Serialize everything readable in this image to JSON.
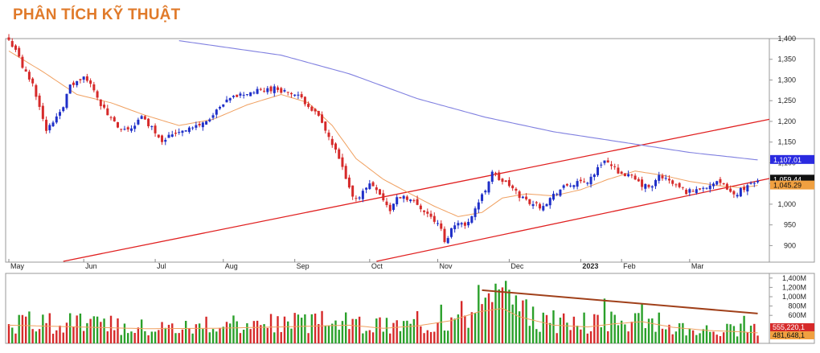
{
  "header": {
    "title": "PHÂN TÍCH KỸ THUẬT"
  },
  "colors": {
    "up": "#1f2fc8",
    "down": "#d62a2a",
    "vol_up": "#2aa02a",
    "vol_down": "#d62a2a",
    "ma_short": "#f0a060",
    "ma_long": "#8080e0",
    "channel": "#e02020",
    "vol_trend": "#a0401a"
  },
  "chart_data": [
    {
      "type": "candlestick",
      "title": "",
      "x_labels": [
        "May",
        "Jun",
        "Jul",
        "Aug",
        "Sep",
        "Oct",
        "Nov",
        "Dec",
        "2023",
        "Feb",
        "Mar"
      ],
      "y_ticks": [
        "1,400",
        "1,350",
        "1,300",
        "1,250",
        "1,200",
        "1,150",
        "1,100",
        "1,050",
        "1,000",
        "950",
        "900"
      ],
      "ylim": [
        860,
        1400
      ],
      "close_path": [
        [
          0,
          1395
        ],
        [
          2,
          1375
        ],
        [
          4,
          1330
        ],
        [
          7,
          1290
        ],
        [
          9,
          1240
        ],
        [
          11,
          1175
        ],
        [
          13,
          1200
        ],
        [
          16,
          1240
        ],
        [
          18,
          1285
        ],
        [
          22,
          1305
        ],
        [
          25,
          1280
        ],
        [
          27,
          1240
        ],
        [
          30,
          1205
        ],
        [
          33,
          1175
        ],
        [
          36,
          1185
        ],
        [
          39,
          1210
        ],
        [
          42,
          1185
        ],
        [
          45,
          1155
        ],
        [
          48,
          1170
        ],
        [
          51,
          1180
        ],
        [
          54,
          1185
        ],
        [
          57,
          1195
        ],
        [
          60,
          1215
        ],
        [
          63,
          1240
        ],
        [
          66,
          1260
        ],
        [
          70,
          1268
        ],
        [
          74,
          1275
        ],
        [
          78,
          1280
        ],
        [
          82,
          1270
        ],
        [
          85,
          1260
        ],
        [
          88,
          1240
        ],
        [
          91,
          1210
        ],
        [
          94,
          1160
        ],
        [
          97,
          1110
        ],
        [
          99,
          1060
        ],
        [
          101,
          1015
        ],
        [
          103,
          1020
        ],
        [
          106,
          1050
        ],
        [
          108,
          1040
        ],
        [
          110,
          1010
        ],
        [
          112,
          985
        ],
        [
          114,
          1015
        ],
        [
          116,
          1020
        ],
        [
          119,
          1005
        ],
        [
          122,
          985
        ],
        [
          125,
          960
        ],
        [
          127,
          940
        ],
        [
          128,
          905
        ],
        [
          130,
          940
        ],
        [
          132,
          960
        ],
        [
          134,
          945
        ],
        [
          136,
          975
        ],
        [
          138,
          1005
        ],
        [
          140,
          1035
        ],
        [
          142,
          1080
        ],
        [
          144,
          1060
        ],
        [
          147,
          1045
        ],
        [
          150,
          1020
        ],
        [
          153,
          1005
        ],
        [
          156,
          995
        ],
        [
          158,
          1005
        ],
        [
          161,
          1030
        ],
        [
          164,
          1045
        ],
        [
          167,
          1050
        ],
        [
          170,
          1055
        ],
        [
          173,
          1085
        ],
        [
          175,
          1110
        ],
        [
          177,
          1090
        ],
        [
          180,
          1075
        ],
        [
          183,
          1065
        ],
        [
          186,
          1045
        ],
        [
          189,
          1040
        ],
        [
          191,
          1070
        ],
        [
          193,
          1060
        ],
        [
          196,
          1045
        ],
        [
          199,
          1030
        ],
        [
          202,
          1035
        ],
        [
          205,
          1045
        ],
        [
          208,
          1050
        ],
        [
          211,
          1040
        ],
        [
          213,
          1020
        ],
        [
          215,
          1035
        ],
        [
          218,
          1050
        ],
        [
          220,
          1059.44
        ]
      ],
      "ma_short_path": [
        [
          0,
          1370
        ],
        [
          10,
          1320
        ],
        [
          20,
          1265
        ],
        [
          30,
          1245
        ],
        [
          40,
          1215
        ],
        [
          50,
          1190
        ],
        [
          60,
          1205
        ],
        [
          70,
          1240
        ],
        [
          80,
          1265
        ],
        [
          88,
          1245
        ],
        [
          95,
          1190
        ],
        [
          102,
          1110
        ],
        [
          110,
          1060
        ],
        [
          118,
          1025
        ],
        [
          125,
          995
        ],
        [
          132,
          970
        ],
        [
          139,
          980
        ],
        [
          145,
          1015
        ],
        [
          152,
          1025
        ],
        [
          160,
          1020
        ],
        [
          168,
          1035
        ],
        [
          176,
          1060
        ],
        [
          184,
          1080
        ],
        [
          192,
          1070
        ],
        [
          200,
          1055
        ],
        [
          208,
          1045
        ],
        [
          215,
          1040
        ],
        [
          220,
          1045.29
        ]
      ],
      "ma_long_path": [
        [
          50,
          1395
        ],
        [
          80,
          1360
        ],
        [
          100,
          1315
        ],
        [
          120,
          1255
        ],
        [
          140,
          1210
        ],
        [
          160,
          1175
        ],
        [
          180,
          1150
        ],
        [
          200,
          1125
        ],
        [
          220,
          1107.01
        ]
      ],
      "channel_lines": [
        {
          "from": [
            16,
            862
          ],
          "to": [
            230,
            1205
          ]
        },
        {
          "from": [
            108,
            862
          ],
          "to": [
            230,
            1062
          ]
        }
      ],
      "last_values": [
        {
          "label": "1,107.01",
          "value": 1107.01,
          "color": "#2a2ae0"
        },
        {
          "label": "1,059.44",
          "value": 1059.44,
          "color": "#111111"
        },
        {
          "label": "1,045.29",
          "value": 1045.29,
          "color": "#f0a040"
        }
      ]
    },
    {
      "type": "bar",
      "title": "",
      "y_ticks": [
        "1,400M",
        "1,200M",
        "1,000M",
        "800M",
        "600M"
      ],
      "ylim": [
        0,
        1500
      ],
      "volume_profile": [
        [
          0,
          520
        ],
        [
          20,
          470
        ],
        [
          40,
          420
        ],
        [
          60,
          430
        ],
        [
          80,
          470
        ],
        [
          100,
          520
        ],
        [
          110,
          430
        ],
        [
          120,
          500
        ],
        [
          130,
          650
        ],
        [
          138,
          900
        ],
        [
          145,
          1000
        ],
        [
          150,
          760
        ],
        [
          160,
          520
        ],
        [
          170,
          470
        ],
        [
          178,
          560
        ],
        [
          186,
          620
        ],
        [
          195,
          460
        ],
        [
          205,
          370
        ],
        [
          215,
          330
        ],
        [
          220,
          300
        ]
      ],
      "spikes": [
        [
          143,
          1280
        ],
        [
          145,
          1200
        ],
        [
          146,
          1340
        ],
        [
          147,
          1150
        ],
        [
          175,
          960
        ],
        [
          191,
          660
        ],
        [
          216,
          590
        ]
      ],
      "trend_line": {
        "from": [
          139,
          1140
        ],
        "to": [
          220,
          640
        ]
      },
      "last_values": [
        {
          "label": "555,220,1",
          "value": 555,
          "color": "#d62a2a"
        },
        {
          "label": "481,648,1",
          "value": 481,
          "color": "#f0a040"
        }
      ]
    }
  ]
}
